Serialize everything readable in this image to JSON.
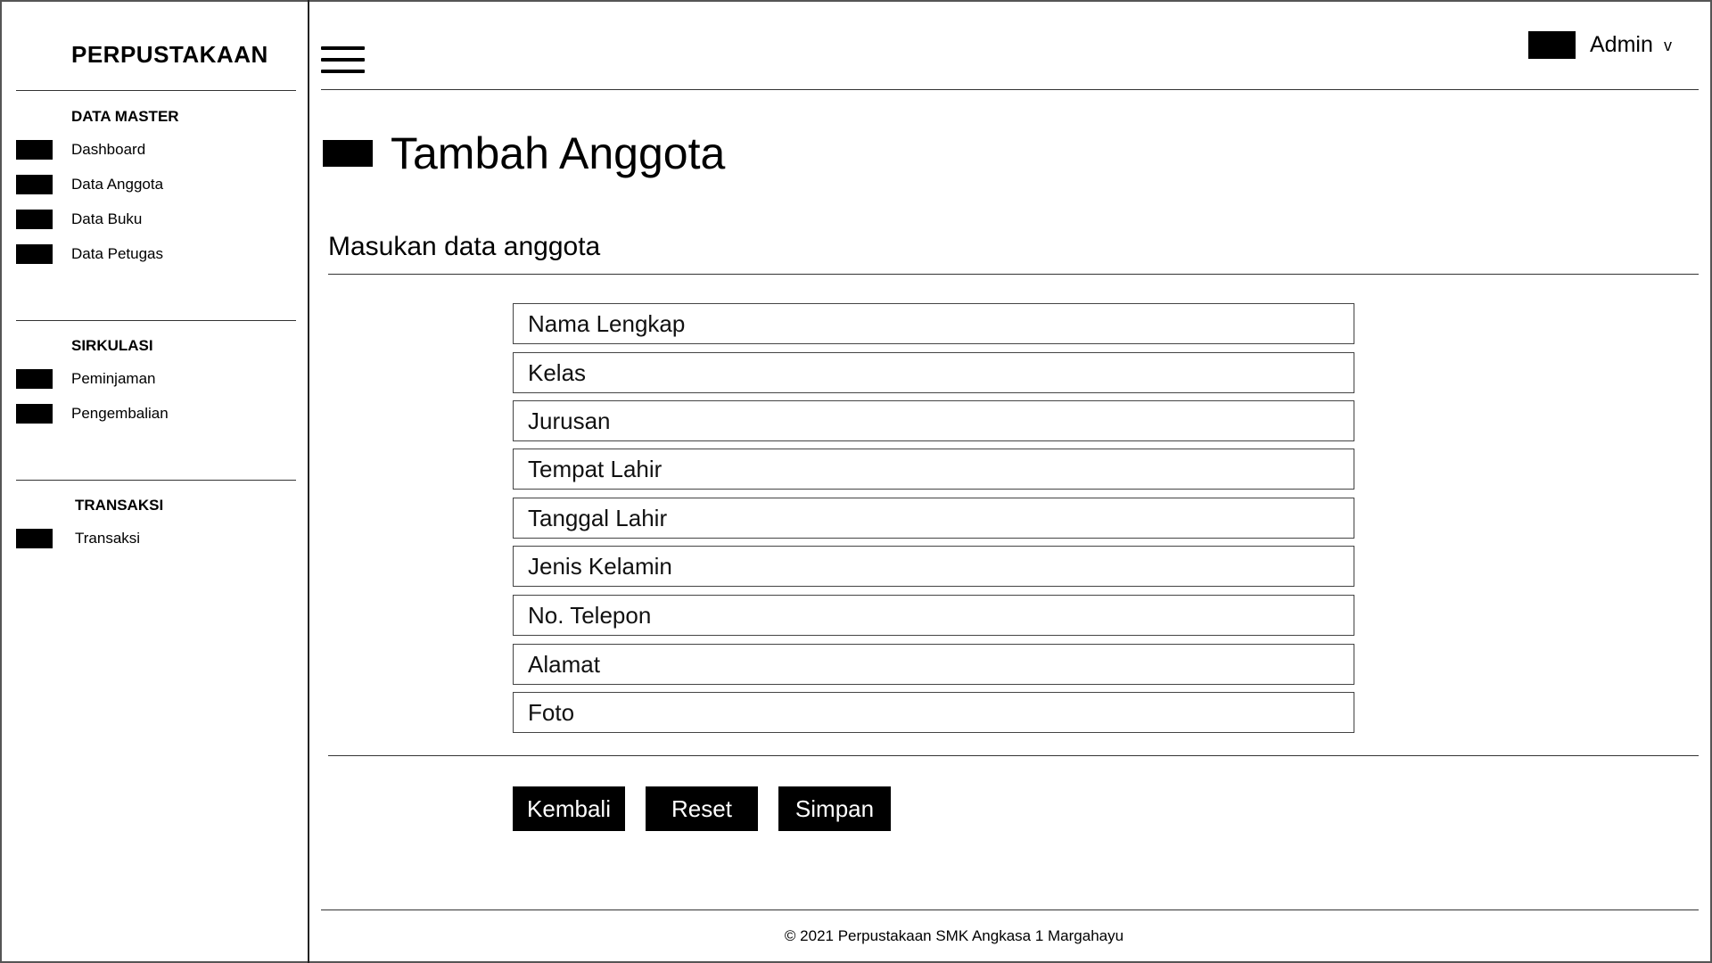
{
  "sidebar": {
    "brand": "PERPUSTAKAAN",
    "sections": [
      {
        "title": "DATA MASTER",
        "items": [
          "Dashboard",
          "Data Anggota",
          "Data Buku",
          "Data Petugas"
        ]
      },
      {
        "title": "SIRKULASI",
        "items": [
          "Peminjaman",
          "Pengembalian"
        ]
      },
      {
        "title": "TRANSAKSI",
        "items": [
          "Transaksi"
        ]
      }
    ]
  },
  "header": {
    "user": "Admin",
    "caret": "v"
  },
  "page": {
    "title": "Tambah Anggota",
    "form_heading": "Masukan data anggota"
  },
  "form": {
    "fields": [
      {
        "placeholder": "Nama Lengkap",
        "value": ""
      },
      {
        "placeholder": "Kelas",
        "value": ""
      },
      {
        "placeholder": "Jurusan",
        "value": ""
      },
      {
        "placeholder": "Tempat Lahir",
        "value": ""
      },
      {
        "placeholder": "Tanggal Lahir",
        "value": ""
      },
      {
        "placeholder": "Jenis Kelamin",
        "value": ""
      },
      {
        "placeholder": "No. Telepon",
        "value": ""
      },
      {
        "placeholder": "Alamat",
        "value": ""
      },
      {
        "placeholder": "Foto",
        "value": ""
      }
    ],
    "buttons": {
      "back": "Kembali",
      "reset": "Reset",
      "save": "Simpan"
    }
  },
  "footer": {
    "text": "© 2021 Perpustakaan SMK Angkasa 1 Margahayu"
  }
}
